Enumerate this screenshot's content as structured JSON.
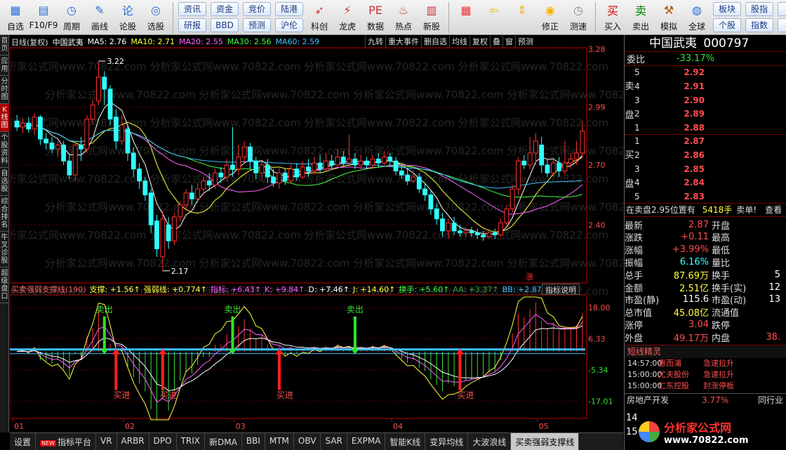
{
  "toolbar": {
    "items": [
      {
        "label": "自选",
        "icon": "grid-icon",
        "color": "#2a6fd6"
      },
      {
        "label": "F10/F9",
        "icon": "f10-icon",
        "color": "#2a6fd6"
      },
      {
        "label": "周期",
        "icon": "clock-icon",
        "color": "#2a6fd6"
      },
      {
        "label": "画线",
        "icon": "pencil-icon",
        "color": "#2a6fd6"
      },
      {
        "label": "论股",
        "icon": "lun-icon",
        "color": "#2a6fd6"
      },
      {
        "label": "选股",
        "icon": "gauge-icon",
        "color": "#2a6fd6"
      }
    ],
    "pairs": [
      [
        "资讯",
        "研报"
      ],
      [
        "资金",
        "BBD"
      ],
      [
        "竞价",
        "预测"
      ],
      [
        "陆港",
        "沪伦"
      ]
    ],
    "items2": [
      {
        "label": "科创",
        "icon": "rocket-icon",
        "color": "#c33"
      },
      {
        "label": "龙虎",
        "icon": "dragon-icon",
        "color": "#c33"
      },
      {
        "label": "数据",
        "icon": "pe-icon",
        "color": "#c33"
      },
      {
        "label": "热点",
        "icon": "fire-icon",
        "color": "#c33"
      },
      {
        "label": "新股",
        "icon": "ipo-icon",
        "color": "#c33"
      }
    ],
    "items3": [
      {
        "label": "",
        "icon": "color-grid-icon",
        "color": "#e33"
      },
      {
        "label": "",
        "icon": "back-arrow-icon",
        "color": "#f4b400"
      },
      {
        "label": "",
        "icon": "updown-icon",
        "color": "#f4b400"
      },
      {
        "label": "修正",
        "icon": "fix-icon",
        "color": "#f4b400"
      },
      {
        "label": "测速",
        "icon": "clock2-icon",
        "color": "#888"
      }
    ],
    "items4": [
      {
        "label": "买入",
        "icon": "buy-icon",
        "color": "#d00"
      },
      {
        "label": "卖出",
        "icon": "sell-icon",
        "color": "#080"
      },
      {
        "label": "模拟",
        "icon": "hammer-icon",
        "color": "#a50"
      },
      {
        "label": "全球",
        "icon": "globe-icon",
        "color": "#2a6fd6"
      }
    ],
    "pairs2": [
      [
        "板块",
        "个股"
      ],
      [
        "股指",
        "指数"
      ],
      [
        "",
        "A"
      ]
    ]
  },
  "sidetabs": [
    "首页",
    "应用",
    "分时图",
    "K线图",
    "个股资料",
    "自选股",
    "综合排名",
    "牛叉诊股",
    "超级盘口"
  ],
  "sidetabs_active": 3,
  "price_header": {
    "period": "日线(复权)",
    "name": "中国武夷",
    "ma5": "MA5: 2.76",
    "ma10": "MA10: 2.71",
    "ma20": "MA20: 2.55",
    "ma30": "MA30: 2.56",
    "ma60": "MA60: 2.59",
    "tools": [
      "九转",
      "重大事件",
      "删自选",
      "均线",
      "复权",
      "叠",
      "窗",
      "预测"
    ]
  },
  "indicator_header": {
    "name": "买卖强弱支撑线(190)",
    "support": "支撑: +1.56↑",
    "strong": "强弱线: +0.774↑",
    "index": "指标: +6.43↑",
    "k": "K: +9.84↑",
    "d": "D: +7.46↑",
    "j": "J: +14.60↑",
    "hs": "换手: +5.60↑",
    "aa": "AA: +3.37↑",
    "bb": "BB: +2.87↑",
    "explain": "指标说明"
  },
  "chart_data": {
    "type": "candlestick",
    "price_axis_ticks": [
      "3.28",
      "2.99",
      "2.70",
      "2.40"
    ],
    "price_ylim": [
      2.12,
      3.28
    ],
    "indicator_axis_ticks": [
      "18.00",
      "6.33",
      "-5.34",
      "-17.01"
    ],
    "indicator_ylim": [
      -24,
      22
    ],
    "x_labels": [
      "01",
      "02",
      "03",
      "04",
      "05"
    ],
    "x_label_index": [
      0,
      19,
      38,
      65,
      90
    ],
    "annot_high": "3.22",
    "annot_low": "2.17",
    "annot_high_idx": 14,
    "annot_low_idx": 25,
    "badge": "涨",
    "badge_idx": 88,
    "watermark": "分析家公式网www.70822.com",
    "candles": [
      [
        2.92,
        2.89,
        2.95,
        2.87
      ],
      [
        2.89,
        2.91,
        2.93,
        2.86
      ],
      [
        2.91,
        2.88,
        2.94,
        2.86
      ],
      [
        2.88,
        2.94,
        2.96,
        2.85
      ],
      [
        2.94,
        2.83,
        2.95,
        2.8
      ],
      [
        2.83,
        2.81,
        2.86,
        2.78
      ],
      [
        2.81,
        2.78,
        2.84,
        2.76
      ],
      [
        2.78,
        2.8,
        2.82,
        2.74
      ],
      [
        2.8,
        2.72,
        2.82,
        2.7
      ],
      [
        2.72,
        2.65,
        2.75,
        2.63
      ],
      [
        2.65,
        2.8,
        2.82,
        2.62
      ],
      [
        2.8,
        2.78,
        2.84,
        2.72
      ],
      [
        2.78,
        2.93,
        2.95,
        2.76
      ],
      [
        2.93,
        3.0,
        3.03,
        2.9
      ],
      [
        3.02,
        3.14,
        3.22,
        3.0
      ],
      [
        3.14,
        3.08,
        3.17,
        3.0
      ],
      [
        3.08,
        2.93,
        3.1,
        2.9
      ],
      [
        2.94,
        2.82,
        2.98,
        2.78
      ],
      [
        2.82,
        2.9,
        2.95,
        2.8
      ],
      [
        2.88,
        2.76,
        2.9,
        2.72
      ],
      [
        2.76,
        2.68,
        2.79,
        2.64
      ],
      [
        2.68,
        2.62,
        2.71,
        2.58
      ],
      [
        2.62,
        2.55,
        2.64,
        2.52
      ],
      [
        2.56,
        2.4,
        2.58,
        2.36
      ],
      [
        2.42,
        2.28,
        2.45,
        2.24
      ],
      [
        2.24,
        2.43,
        2.47,
        2.17
      ],
      [
        2.4,
        2.32,
        2.44,
        2.28
      ],
      [
        2.32,
        2.44,
        2.46,
        2.3
      ],
      [
        2.44,
        2.5,
        2.52,
        2.42
      ],
      [
        2.5,
        2.56,
        2.58,
        2.47
      ],
      [
        2.56,
        2.53,
        2.6,
        2.5
      ],
      [
        2.53,
        2.58,
        2.61,
        2.51
      ],
      [
        2.58,
        2.62,
        2.64,
        2.55
      ],
      [
        2.62,
        2.6,
        2.66,
        2.57
      ],
      [
        2.6,
        2.66,
        2.68,
        2.58
      ],
      [
        2.66,
        2.64,
        2.69,
        2.61
      ],
      [
        2.64,
        2.7,
        2.73,
        2.62
      ],
      [
        2.7,
        2.68,
        2.89,
        2.64
      ],
      [
        2.68,
        2.74,
        2.8,
        2.65
      ],
      [
        2.74,
        2.79,
        2.82,
        2.71
      ],
      [
        2.79,
        2.72,
        2.81,
        2.68
      ],
      [
        2.72,
        2.66,
        2.74,
        2.63
      ],
      [
        2.66,
        2.7,
        2.72,
        2.62
      ],
      [
        2.7,
        2.64,
        2.73,
        2.61
      ],
      [
        2.64,
        2.61,
        2.68,
        2.59
      ],
      [
        2.61,
        2.66,
        2.69,
        2.58
      ],
      [
        2.66,
        2.62,
        2.68,
        2.6
      ],
      [
        2.62,
        2.68,
        2.7,
        2.61
      ],
      [
        2.68,
        2.64,
        2.71,
        2.62
      ],
      [
        2.64,
        2.69,
        2.72,
        2.63
      ],
      [
        2.69,
        2.67,
        2.73,
        2.64
      ],
      [
        2.67,
        2.71,
        2.74,
        2.65
      ],
      [
        2.71,
        2.68,
        2.75,
        2.66
      ],
      [
        2.68,
        2.72,
        2.76,
        2.67
      ],
      [
        2.72,
        2.7,
        2.75,
        2.68
      ],
      [
        2.7,
        2.74,
        2.78,
        2.69
      ],
      [
        2.74,
        2.71,
        2.77,
        2.69
      ],
      [
        2.71,
        2.73,
        2.85,
        2.7
      ],
      [
        2.73,
        2.7,
        2.76,
        2.68
      ],
      [
        2.7,
        2.72,
        2.75,
        2.68
      ],
      [
        2.72,
        2.7,
        2.74,
        2.68
      ],
      [
        2.7,
        2.73,
        2.75,
        2.68
      ],
      [
        2.73,
        2.71,
        2.76,
        2.69
      ],
      [
        2.71,
        2.74,
        2.77,
        2.7
      ],
      [
        2.74,
        2.72,
        2.76,
        2.7
      ],
      [
        2.72,
        2.67,
        2.74,
        2.65
      ],
      [
        2.67,
        2.65,
        2.7,
        2.63
      ],
      [
        2.65,
        2.62,
        2.68,
        2.6
      ],
      [
        2.62,
        2.64,
        2.67,
        2.61
      ],
      [
        2.64,
        2.58,
        2.66,
        2.56
      ],
      [
        2.58,
        2.55,
        2.61,
        2.52
      ],
      [
        2.55,
        2.48,
        2.57,
        2.45
      ],
      [
        2.48,
        2.43,
        2.51,
        2.4
      ],
      [
        2.43,
        2.37,
        2.46,
        2.34
      ],
      [
        2.37,
        2.41,
        2.43,
        2.33
      ],
      [
        2.41,
        2.37,
        2.44,
        2.35
      ],
      [
        2.37,
        2.36,
        2.4,
        2.34
      ],
      [
        2.36,
        2.37,
        2.39,
        2.34
      ],
      [
        2.37,
        2.36,
        2.39,
        2.34
      ],
      [
        2.36,
        2.35,
        2.38,
        2.33
      ],
      [
        2.35,
        2.34,
        2.37,
        2.32
      ],
      [
        2.34,
        2.36,
        2.38,
        2.33
      ],
      [
        2.36,
        2.35,
        2.38,
        2.33
      ],
      [
        2.35,
        2.41,
        2.43,
        2.34
      ],
      [
        2.41,
        2.48,
        2.5,
        2.39
      ],
      [
        2.48,
        2.58,
        2.6,
        2.46
      ],
      [
        2.58,
        2.72,
        2.74,
        2.55
      ],
      [
        2.72,
        2.7,
        2.75,
        2.68
      ],
      [
        2.7,
        2.76,
        2.84,
        2.68
      ],
      [
        2.76,
        2.82,
        2.86,
        2.7
      ],
      [
        2.8,
        2.7,
        2.84,
        2.66
      ],
      [
        2.7,
        2.66,
        2.73,
        2.64
      ],
      [
        2.66,
        2.71,
        2.74,
        2.64
      ],
      [
        2.71,
        2.67,
        2.74,
        2.64
      ],
      [
        2.67,
        2.71,
        2.82,
        2.65
      ],
      [
        2.71,
        2.73,
        2.76,
        2.68
      ],
      [
        2.73,
        2.76,
        2.82,
        2.7
      ],
      [
        2.76,
        2.87,
        2.92,
        2.74
      ]
    ],
    "series": [
      {
        "name": "MA5",
        "color": "#ffffff"
      },
      {
        "name": "MA10",
        "color": "#ffff40"
      },
      {
        "name": "MA20",
        "color": "#ff60ff"
      },
      {
        "name": "MA30",
        "color": "#40ff40"
      },
      {
        "name": "MA60",
        "color": "#40c0ff"
      }
    ],
    "buy_signals": [
      {
        "idx": 17,
        "label": "买进"
      },
      {
        "idx": 25,
        "label": "买进"
      },
      {
        "idx": 45,
        "label": "买进"
      },
      {
        "idx": 76,
        "label": "买进"
      }
    ],
    "sell_signals": [
      {
        "idx": 15,
        "label": "卖出"
      },
      {
        "idx": 37,
        "label": "卖出"
      },
      {
        "idx": 58,
        "label": "卖出"
      }
    ]
  },
  "bottom_tabs": [
    "设置",
    "指标平台",
    "VR",
    "ARBR",
    "DPO",
    "TRIX",
    "新DMA",
    "BBI",
    "MTM",
    "OBV",
    "SAR",
    "EXPMA",
    "智能K线",
    "变异均线",
    "大波浪线",
    "买卖强弱支撑线"
  ],
  "bottom_new_badge": "NEW",
  "bottom_active": 15,
  "stock": {
    "name": "中国武夷",
    "code": "000797"
  },
  "orderbook": {
    "weibi_label": "委比",
    "weibi": "-33.17%",
    "sell_label": [
      "卖",
      "盘"
    ],
    "sells": [
      {
        "n": "5",
        "p": "2.92"
      },
      {
        "n": "4",
        "p": "2.91"
      },
      {
        "n": "3",
        "p": "2.90"
      },
      {
        "n": "2",
        "p": "2.89"
      },
      {
        "n": "1",
        "p": "2.88"
      }
    ],
    "buy_label": [
      "买",
      "盘"
    ],
    "buys": [
      {
        "n": "1",
        "p": "2.87"
      },
      {
        "n": "2",
        "p": "2.86"
      },
      {
        "n": "3",
        "p": "2.85"
      },
      {
        "n": "4",
        "p": "2.84"
      },
      {
        "n": "5",
        "p": "2.83"
      }
    ],
    "note": "在卖盘2.95位置有",
    "note_vol": "5418手",
    "note_tail": "卖单!",
    "note_view": "查看"
  },
  "quote": [
    {
      "k": "最新",
      "v": "2.87",
      "vc": "red",
      "k2": "开盘",
      "v2": ""
    },
    {
      "k": "涨跌",
      "v": "+0.11",
      "vc": "red",
      "k2": "最高",
      "v2": ""
    },
    {
      "k": "涨幅",
      "v": "+3.99%",
      "vc": "red",
      "k2": "最低",
      "v2": ""
    },
    {
      "k": "振幅",
      "v": "6.16%",
      "vc": "cyn",
      "k2": "量比",
      "v2": ""
    },
    {
      "k": "总手",
      "v": "87.69万",
      "vc": "yel",
      "k2": "换手",
      "v2": "5"
    },
    {
      "k": "金额",
      "v": "2.51亿",
      "vc": "yel",
      "k2": "换手(实)",
      "v2": "12"
    },
    {
      "k": "市盈(静)",
      "v": "115.6",
      "vc": "wht",
      "k2": "市盈(动)",
      "v2": "13"
    },
    {
      "k": "总市值",
      "v": "45.08亿",
      "vc": "yel",
      "k2": "流通值",
      "v2": ""
    },
    {
      "k": "涨停",
      "v": "3.04",
      "vc": "red",
      "k2": "跌停",
      "v2": ""
    },
    {
      "k": "外盘",
      "v": "49.17万",
      "vc": "red",
      "k2": "内盘",
      "v2": "38."
    }
  ],
  "sprite": {
    "title": "短线精灵",
    "rows": [
      {
        "t": "14:57:00",
        "s": "惠而浦",
        "e": "急速拉升"
      },
      {
        "t": "15:00:00",
        "s": "尤夫股份",
        "e": "急速拉升"
      },
      {
        "t": "15:00:00",
        "s": "仁东控股",
        "e": "封涨停板"
      }
    ]
  },
  "sector": {
    "name": "房地产开发",
    "pct": "3.77%",
    "tail": "同行业"
  },
  "clock_partial": [
    "14",
    "15"
  ],
  "logo": {
    "line1": "分析家公式网",
    "line2": "www.70822.com"
  }
}
